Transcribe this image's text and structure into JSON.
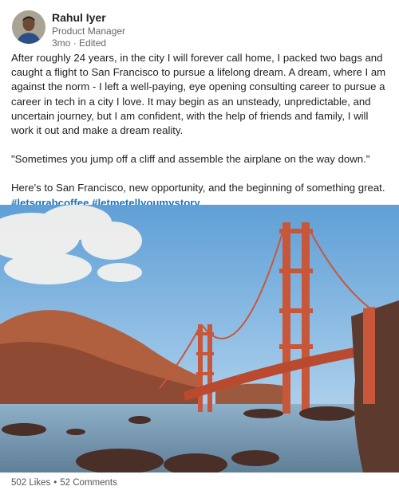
{
  "post": {
    "author": {
      "name": "Rahul Iyer",
      "headline": "Product Manager",
      "time": "3mo",
      "edited": "Edited"
    },
    "paragraphs": [
      "After roughly 24 years, in the city I will forever call home, I packed two bags and caught a flight to San Francisco to pursue a lifelong dream. A dream, where I am against the norm - I left a well-paying, eye opening consulting career to pursue a career in tech in a city I love. It may begin as an unsteady, unpredictable, and uncertain journey, but I am confident, with the help of friends and family, I will work it out and make a dream reality.",
      "\"Sometimes you jump off a cliff and assemble the airplane on the way down.\"",
      "Here's to San Francisco, new opportunity, and the beginning of something great."
    ],
    "hashtags": "#letsgrabcoffee #letmetellyoumystory",
    "image_alt": "Golden Gate Bridge",
    "stats": {
      "likes": "502 Likes",
      "separator": "•",
      "comments": "52 Comments"
    }
  },
  "colors": {
    "hashtag": "#1a74b8",
    "bridge": "#c8573a",
    "sky": "#7fb2de",
    "water": "#7f9ab0"
  }
}
